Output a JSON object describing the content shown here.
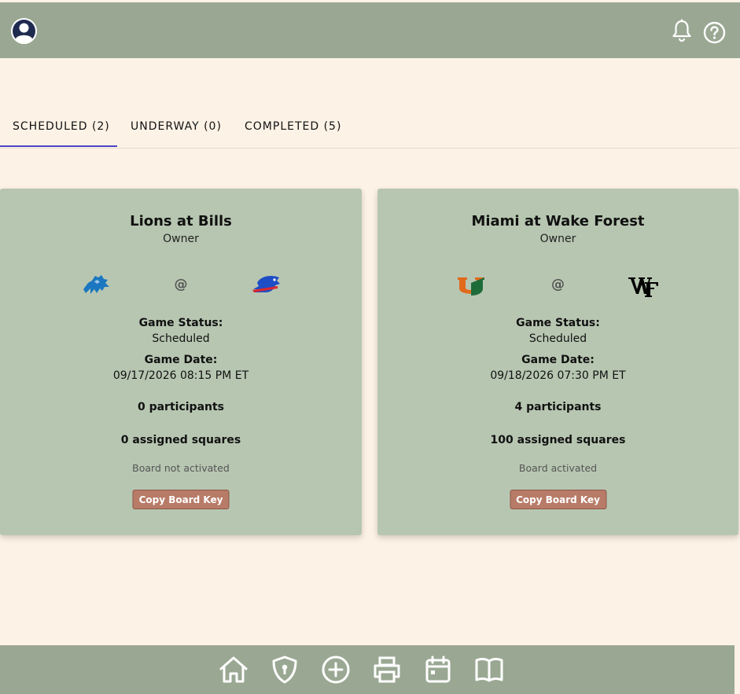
{
  "header": {
    "avatar_icon": "user-avatar-icon",
    "notifications_icon": "bell-icon",
    "help_icon": "question-circle-icon"
  },
  "tabs": [
    {
      "label": "SCHEDULED (2)",
      "active": true
    },
    {
      "label": "UNDERWAY (0)",
      "active": false
    },
    {
      "label": "COMPLETED (5)",
      "active": false
    }
  ],
  "games": [
    {
      "title": "Lions at Bills",
      "role": "Owner",
      "away_logo": "lions-logo-icon",
      "home_logo": "bills-logo-icon",
      "at_symbol": "@",
      "status_label": "Game Status:",
      "status": "Scheduled",
      "date_label": "Game Date:",
      "date": "09/17/2026 08:15 PM ET",
      "participants": "0 participants",
      "squares": "0 assigned squares",
      "activation": "Board not activated",
      "copy_label": "Copy Board Key"
    },
    {
      "title": "Miami at Wake Forest",
      "role": "Owner",
      "away_logo": "miami-u-logo-icon",
      "home_logo": "wake-forest-logo-icon",
      "at_symbol": "@",
      "status_label": "Game Status:",
      "status": "Scheduled",
      "date_label": "Game Date:",
      "date": "09/18/2026 07:30 PM ET",
      "participants": "4 participants",
      "squares": "100 assigned squares",
      "activation": "Board activated",
      "copy_label": "Copy Board Key"
    }
  ],
  "bottom_nav": [
    "home-icon",
    "shield-icon",
    "add-circle-icon",
    "print-icon",
    "calendar-icon",
    "book-icon"
  ],
  "colors": {
    "background": "#fdf2e6",
    "bar": "#9aa893",
    "card": "#b7c6b1",
    "button": "#b77b68",
    "tab_indicator": "#4b45c4"
  }
}
